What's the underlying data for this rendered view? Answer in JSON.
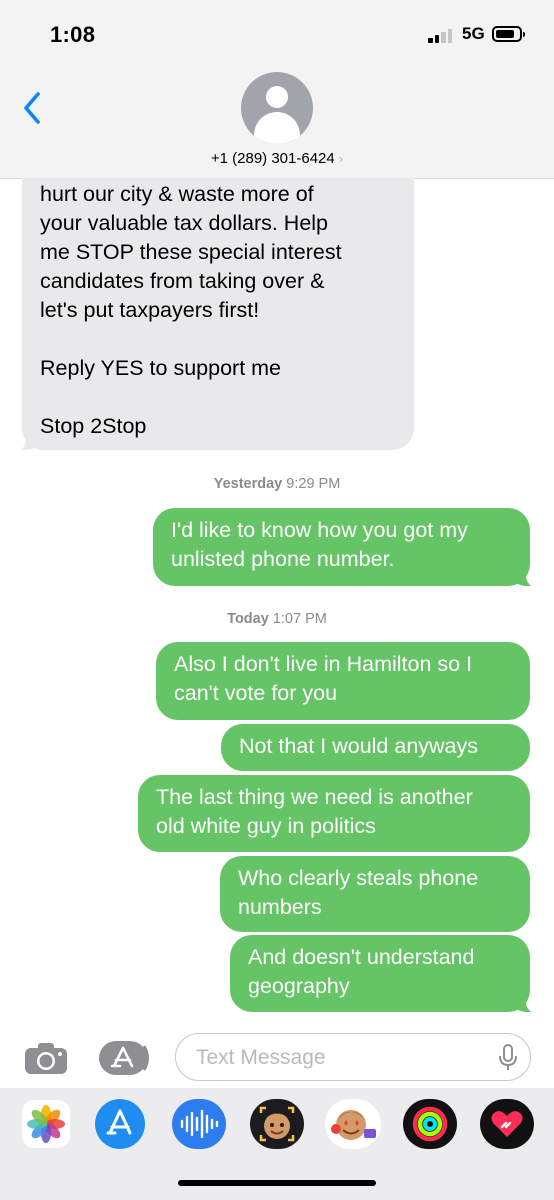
{
  "status_bar": {
    "time": "1:08",
    "network": "5G"
  },
  "header": {
    "contact": "+1 (289) 301-6424"
  },
  "messages": {
    "incoming": [
      "hurt our city & waste more of",
      "your valuable tax dollars. Help",
      "me STOP these special interest",
      "candidates from taking over &",
      "let's put taxpayers first!",
      "",
      "Reply YES to support me",
      "",
      "Stop 2Stop"
    ],
    "stamp1": {
      "day": "Yesterday",
      "time": "9:29 PM"
    },
    "out1": [
      "I'd like to know how you got my",
      "unlisted phone number."
    ],
    "stamp2": {
      "day": "Today",
      "time": "1:07 PM"
    },
    "out2": [
      "Also I don't live in Hamilton so I",
      "can't vote for you"
    ],
    "out3": [
      "Not that I would anyways"
    ],
    "out4": [
      "The last thing we need is another",
      "old white guy in politics"
    ],
    "out5": [
      "Who clearly steals phone",
      "numbers"
    ],
    "out6": [
      "And doesn't understand",
      "geography"
    ]
  },
  "composer": {
    "placeholder": "Text Message"
  },
  "drawer_apps": [
    "photos-icon",
    "app-store-icon",
    "audio-message-icon",
    "memoji-icon",
    "memoji-stickers-icon",
    "activity-icon",
    "digital-touch-icon"
  ],
  "colors": {
    "outgoing": "#65c466",
    "incoming": "#e9e9eb",
    "accent": "#0a84ff"
  }
}
